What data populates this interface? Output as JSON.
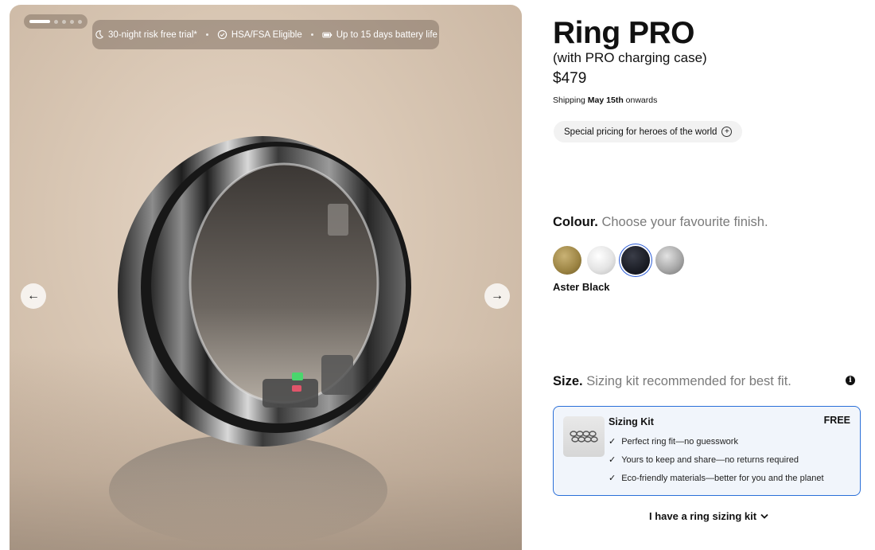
{
  "gallery": {
    "image_alt": "Ring PRO in Aster Black",
    "features": [
      {
        "icon": "moon-icon",
        "label": "30-night risk free trial*"
      },
      {
        "icon": "check-circle-icon",
        "label": "HSA/FSA Eligible"
      },
      {
        "icon": "battery-icon",
        "label": "Up to 15 days battery life"
      }
    ],
    "prev_icon": "←",
    "next_icon": "→",
    "slide_count": 5,
    "active_slide": 1
  },
  "product": {
    "title": "Ring PRO",
    "subtitle": "(with PRO charging case)",
    "price": "$479",
    "shipping_prefix": "Shipping ",
    "shipping_date": "May 15th",
    "shipping_suffix": " onwards",
    "promo": "Special pricing for heroes of the world",
    "promo_icon": "+"
  },
  "colour": {
    "heading": "Colour.",
    "subheading": "Choose your favourite finish.",
    "options": [
      "gold",
      "silver",
      "black",
      "titanium"
    ],
    "selected_label": "Aster Black"
  },
  "size": {
    "heading": "Size.",
    "subheading": "Sizing kit recommended for best fit.",
    "info_icon": "i",
    "kit": {
      "title": "Sizing Kit",
      "price": "FREE",
      "features": [
        "Perfect ring fit—no guesswork",
        "Yours to keep and share—no returns required",
        "Eco-friendly materials—better for you and the planet"
      ],
      "check_icon": "✓"
    },
    "alt_option": "I have a ring sizing kit",
    "chevron": "⌄"
  },
  "colors": {
    "accent": "#2a6fd8",
    "card_bg": "#f1f5fb"
  }
}
